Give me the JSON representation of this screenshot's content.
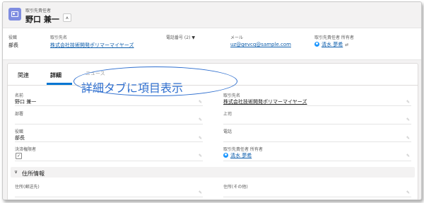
{
  "header": {
    "object_label": "取引先責任者",
    "record_name": "野口 兼一",
    "hierarchy_icon": "hierarchy-icon"
  },
  "highlights": {
    "fields": [
      {
        "label": "役職",
        "value": "部長"
      },
      {
        "label": "取引先名",
        "value": "株式会社技術開発ポリマーマイヤーズ"
      },
      {
        "label": "電話番号 (2)",
        "value": ""
      },
      {
        "label": "メール",
        "value": "uz@gevcq@sample.com"
      },
      {
        "label": "取引先責任者 所有者",
        "value": "清水 夢希"
      }
    ]
  },
  "tabs": [
    {
      "label": "関連"
    },
    {
      "label": "詳細"
    },
    {
      "label": "ニュース"
    }
  ],
  "annotation": {
    "text": "詳細タブに項目表示"
  },
  "details": {
    "left": [
      {
        "label": "名前",
        "value": "野口 兼一"
      },
      {
        "label": "部署",
        "value": ""
      },
      {
        "label": "役職",
        "value": "部長"
      },
      {
        "label": "決済権限者",
        "value": "✓"
      }
    ],
    "right": [
      {
        "label": "取引先名",
        "value": "株式会社技術開発ポリマーマイヤーズ"
      },
      {
        "label": "上司",
        "value": ""
      },
      {
        "label": "電話",
        "value": ""
      },
      {
        "label": "取引先責任者 所有者",
        "value": "清水 夢希"
      }
    ]
  },
  "address_section": {
    "title": "住所情報",
    "left_label": "住所(郵送先)",
    "right_label": "住所(その他)"
  },
  "colors": {
    "accent": "#0176d3",
    "link": "#0b5cab",
    "annotation": "#2f6fcf",
    "record_icon": "#7f8de1"
  }
}
